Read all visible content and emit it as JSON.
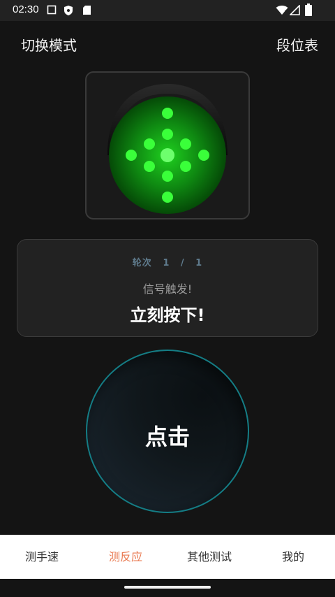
{
  "status_bar": {
    "time": "02:30",
    "icons": [
      "screen-icon",
      "shield-icon",
      "sd-card-icon",
      "wifi-icon",
      "signal-icon",
      "battery-icon"
    ]
  },
  "top_bar": {
    "left_label": "切换模式",
    "right_label": "段位表"
  },
  "light": {
    "state": "green",
    "color": "#22ff2a"
  },
  "info": {
    "round_label": "轮次",
    "round_current": "1",
    "round_separator": "/",
    "round_total": "1",
    "signal_text": "信号触发!",
    "instruction": "立刻按下!"
  },
  "click_button": {
    "label": "点击"
  },
  "bottom_nav": {
    "items": [
      {
        "label": "测手速"
      },
      {
        "label": "测反应",
        "active": true
      },
      {
        "label": "其他测试"
      },
      {
        "label": "我的"
      }
    ]
  },
  "colors": {
    "active_tab": "#e9784f",
    "button_border": "#147d85",
    "round_text": "#5f7b8d"
  }
}
